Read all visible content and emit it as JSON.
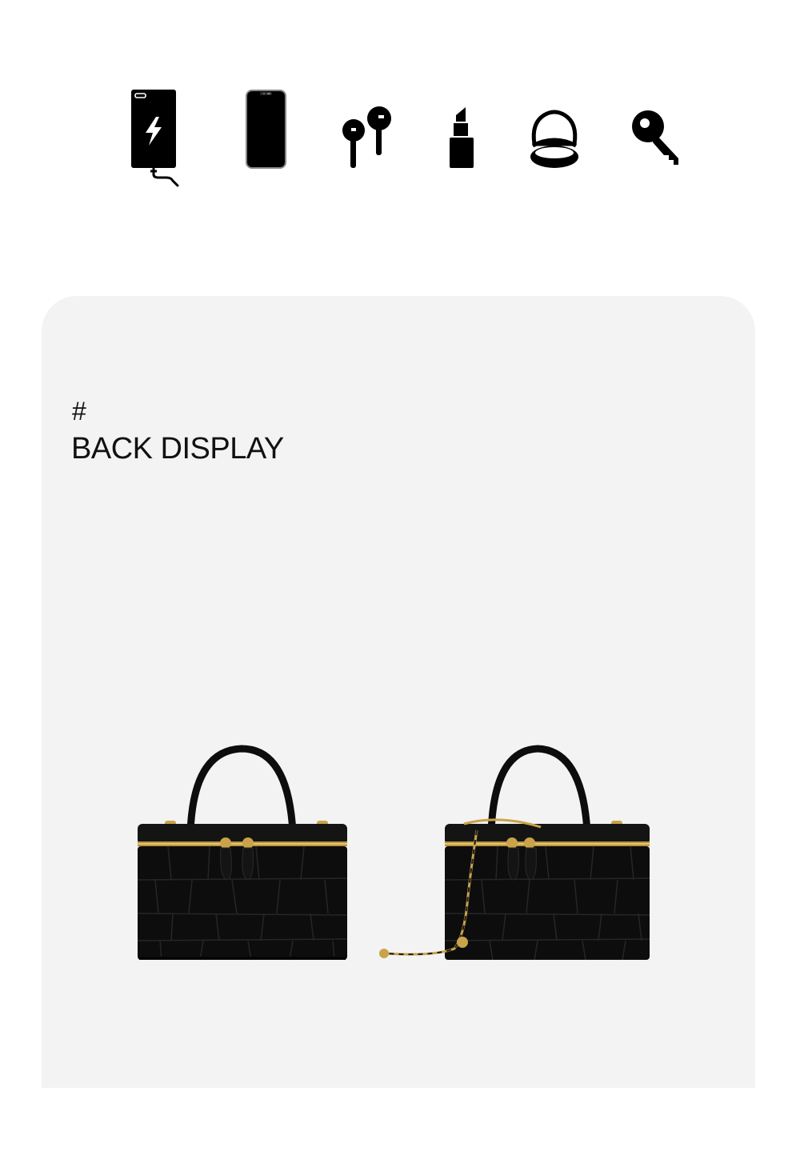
{
  "icons": [
    {
      "name": "charging-phone-icon"
    },
    {
      "name": "smartphone-icon"
    },
    {
      "name": "earbuds-icon"
    },
    {
      "name": "lipstick-icon"
    },
    {
      "name": "compact-mirror-icon"
    },
    {
      "name": "key-icon"
    }
  ],
  "section": {
    "mark": "#",
    "title": "BACK DISPLAY"
  },
  "colors": {
    "panel_background": "#f3f3f3",
    "icon_color": "#000000",
    "bag_leather": "#0d0d0d",
    "hardware_gold": "#c9a34a"
  }
}
